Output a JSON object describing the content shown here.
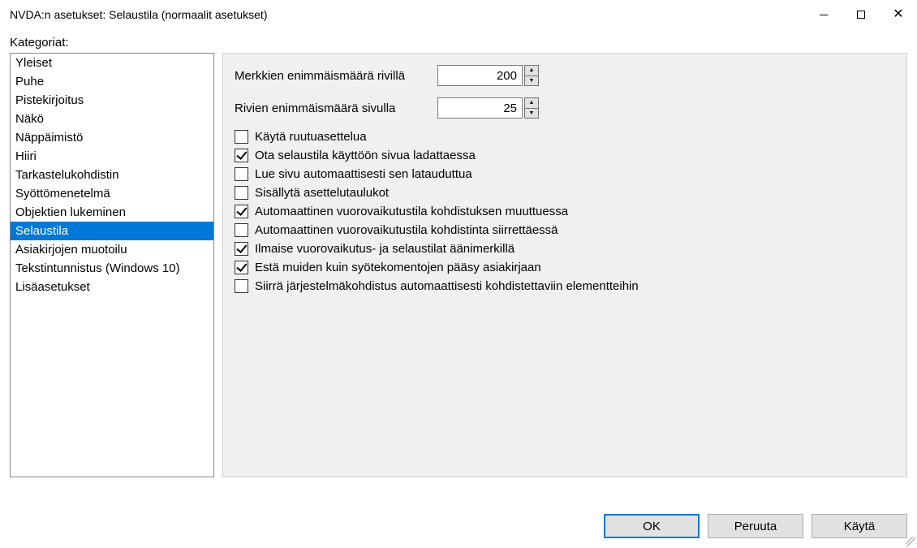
{
  "window": {
    "title": "NVDA:n asetukset: Selaustila (normaalit asetukset)"
  },
  "categories_label": "Kategoriat:",
  "categories": [
    "Yleiset",
    "Puhe",
    "Pistekirjoitus",
    "Näkö",
    "Näppäimistö",
    "Hiiri",
    "Tarkastelukohdistin",
    "Syöttömenetelmä",
    "Objektien lukeminen",
    "Selaustila",
    "Asiakirjojen muotoilu",
    "Tekstintunnistus (Windows 10)",
    "Lisäasetukset"
  ],
  "selected_category_index": 9,
  "numeric": {
    "max_chars_label": "Merkkien enimmäismäärä rivillä",
    "max_chars_value": "200",
    "max_lines_label": "Rivien enimmäismäärä sivulla",
    "max_lines_value": "25"
  },
  "checkboxes": [
    {
      "label": "Käytä ruutuasettelua",
      "checked": false
    },
    {
      "label": "Ota selaustila käyttöön sivua ladattaessa",
      "checked": true
    },
    {
      "label": "Lue sivu automaattisesti sen latauduttua",
      "checked": false
    },
    {
      "label": "Sisällytä asettelutaulukot",
      "checked": false
    },
    {
      "label": "Automaattinen vuorovaikutustila kohdistuksen muuttuessa",
      "checked": true
    },
    {
      "label": "Automaattinen vuorovaikutustila kohdistinta siirrettäessä",
      "checked": false
    },
    {
      "label": "Ilmaise vuorovaikutus- ja selaustilat äänimerkillä",
      "checked": true
    },
    {
      "label": "Estä muiden kuin syötekomentojen pääsy asiakirjaan",
      "checked": true
    },
    {
      "label": "Siirrä järjestelmäkohdistus automaattisesti kohdistettaviin elementteihin",
      "checked": false
    }
  ],
  "buttons": {
    "ok": "OK",
    "cancel": "Peruuta",
    "apply": "Käytä"
  }
}
